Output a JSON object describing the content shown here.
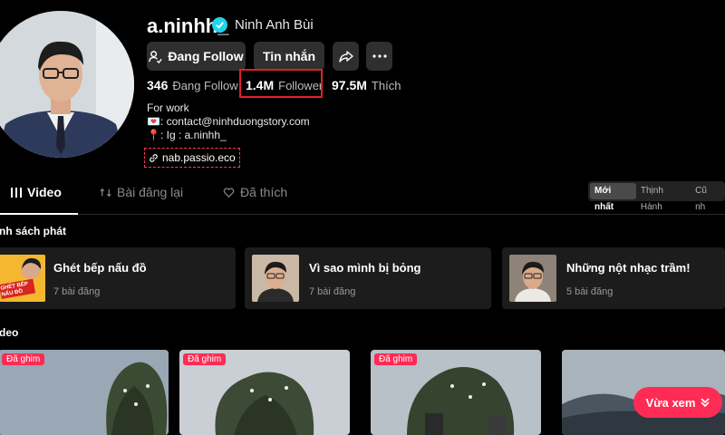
{
  "profile": {
    "username": "a.ninhh_",
    "display_name": "Ninh Anh Bùi",
    "buttons": {
      "follow": "Đang Follow",
      "message": "Tin nhắn"
    },
    "stats": [
      {
        "value": "346",
        "label": "Đang Follow"
      },
      {
        "value": "1.4M",
        "label": "Follower"
      },
      {
        "value": "97.5M",
        "label": "Thích"
      }
    ],
    "bio": [
      "For work",
      "💌: contact@ninhduongstory.com",
      "📍: Ig : a.ninhh_"
    ],
    "link": "nab.passio.eco"
  },
  "tabs": [
    {
      "label": "Video"
    },
    {
      "label": "Bài đăng lại"
    },
    {
      "label": "Đã thích"
    }
  ],
  "sort": [
    "Mới nhất",
    "Thịnh Hành",
    "Cũ nh"
  ],
  "playlists_title": "nh sách phát",
  "playlists": [
    {
      "name": "Ghét bếp nấu đồ",
      "count": "7 bài đăng",
      "thumb_text": "GHÉT BẾP NẤU ĐỒ"
    },
    {
      "name": "Vì sao mình bị bỏng",
      "count": "7 bài đăng"
    },
    {
      "name": "Những nột nhạc trầm!",
      "count": "5 bài đăng"
    }
  ],
  "videos_title": "deo",
  "videos": [
    {
      "pinned": "Đã ghim"
    },
    {
      "pinned": "Đã ghim"
    },
    {
      "pinned": "Đã ghim"
    },
    {
      "pinned": ""
    }
  ],
  "seen_button": "Vừa xem",
  "colors": {
    "accent": "#fe2c55",
    "verified": "#20d5ec",
    "highlight": "#e0202a"
  }
}
